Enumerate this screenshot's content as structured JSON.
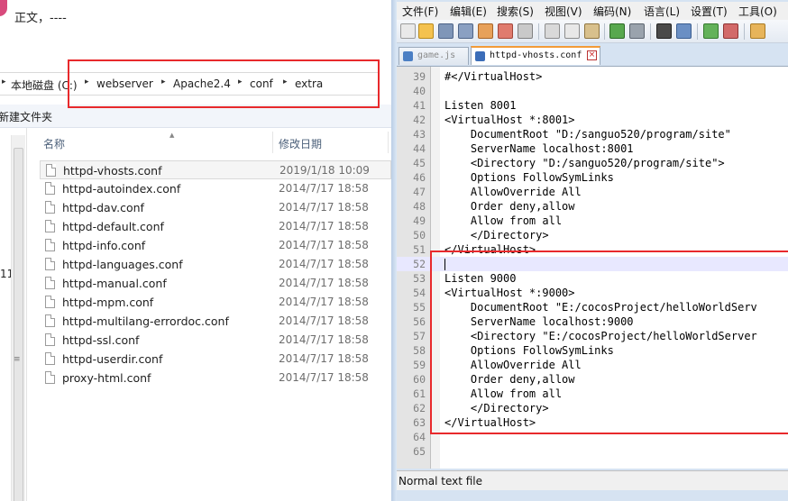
{
  "explorer": {
    "top_text": "正文，----",
    "breadcrumb": [
      "本地磁盘 (C:)",
      "webserver",
      "Apache2.4",
      "conf",
      "extra"
    ],
    "new_folder_label": "新建文件夹",
    "pane_number": "11",
    "columns": {
      "name": "名称",
      "date": "修改日期"
    },
    "files": [
      {
        "name": "httpd-vhosts.conf",
        "date": "2019/1/18 10:09"
      },
      {
        "name": "httpd-autoindex.conf",
        "date": "2014/7/17 18:58"
      },
      {
        "name": "httpd-dav.conf",
        "date": "2014/7/17 18:58"
      },
      {
        "name": "httpd-default.conf",
        "date": "2014/7/17 18:58"
      },
      {
        "name": "httpd-info.conf",
        "date": "2014/7/17 18:58"
      },
      {
        "name": "httpd-languages.conf",
        "date": "2014/7/17 18:58"
      },
      {
        "name": "httpd-manual.conf",
        "date": "2014/7/17 18:58"
      },
      {
        "name": "httpd-mpm.conf",
        "date": "2014/7/17 18:58"
      },
      {
        "name": "httpd-multilang-errordoc.conf",
        "date": "2014/7/17 18:58"
      },
      {
        "name": "httpd-ssl.conf",
        "date": "2014/7/17 18:58"
      },
      {
        "name": "httpd-userdir.conf",
        "date": "2014/7/17 18:58"
      },
      {
        "name": "proxy-html.conf",
        "date": "2014/7/17 18:58"
      }
    ]
  },
  "notepad": {
    "menu": [
      "文件(F)",
      "编辑(E)",
      "搜索(S)",
      "视图(V)",
      "编码(N)",
      "语言(L)",
      "设置(T)",
      "工具(O)"
    ],
    "tabs": [
      {
        "label": "game.js",
        "active": false
      },
      {
        "label": "httpd-vhosts.conf",
        "active": true
      }
    ],
    "lines": [
      {
        "n": "39",
        "text": "#</VirtualHost>"
      },
      {
        "n": "40",
        "text": ""
      },
      {
        "n": "41",
        "text": "Listen 8001"
      },
      {
        "n": "42",
        "text": "<VirtualHost *:8001>"
      },
      {
        "n": "43",
        "text": "    DocumentRoot \"D:/sanguo520/program/site\""
      },
      {
        "n": "44",
        "text": "    ServerName localhost:8001"
      },
      {
        "n": "45",
        "text": "    <Directory \"D:/sanguo520/program/site\">"
      },
      {
        "n": "46",
        "text": "    Options FollowSymLinks"
      },
      {
        "n": "47",
        "text": "    AllowOverride All"
      },
      {
        "n": "48",
        "text": "    Order deny,allow"
      },
      {
        "n": "49",
        "text": "    Allow from all"
      },
      {
        "n": "50",
        "text": "    </Directory>"
      },
      {
        "n": "51",
        "text": "</VirtualHost>"
      },
      {
        "n": "52",
        "text": ""
      },
      {
        "n": "53",
        "text": "Listen 9000"
      },
      {
        "n": "54",
        "text": "<VirtualHost *:9000>"
      },
      {
        "n": "55",
        "text": "    DocumentRoot \"E:/cocosProject/helloWorldServ"
      },
      {
        "n": "56",
        "text": "    ServerName localhost:9000"
      },
      {
        "n": "57",
        "text": "    <Directory \"E:/cocosProject/helloWorldServer"
      },
      {
        "n": "58",
        "text": "    Options FollowSymLinks"
      },
      {
        "n": "59",
        "text": "    AllowOverride All"
      },
      {
        "n": "60",
        "text": "    Order deny,allow"
      },
      {
        "n": "61",
        "text": "    Allow from all"
      },
      {
        "n": "62",
        "text": "    </Directory>"
      },
      {
        "n": "63",
        "text": "</VirtualHost>"
      },
      {
        "n": "64",
        "text": ""
      },
      {
        "n": "65",
        "text": ""
      }
    ],
    "current_line": "52",
    "status": "Normal text file"
  },
  "colors": {
    "highlight_box": "#e8292c",
    "tab_accent": "#f29b38",
    "current_line_bg": "#e8e8ff"
  }
}
